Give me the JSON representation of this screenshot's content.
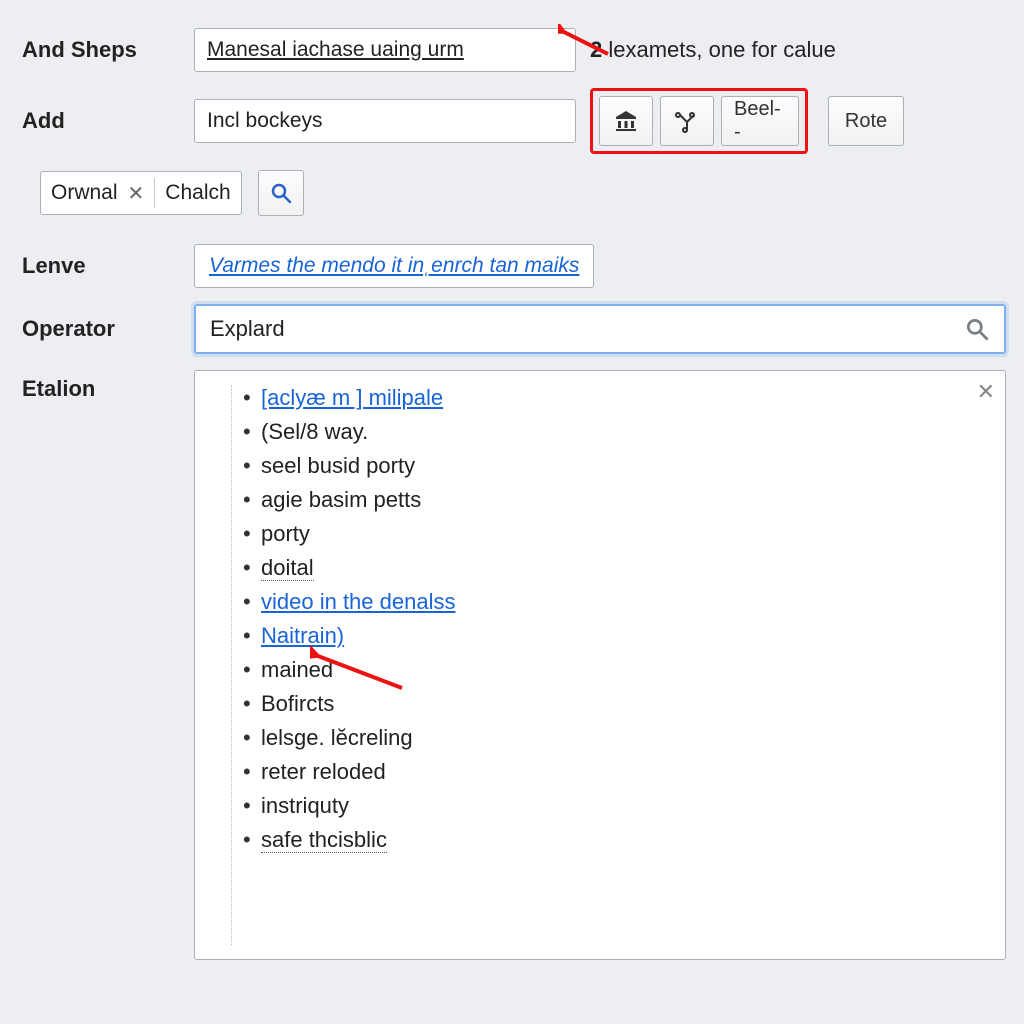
{
  "row1": {
    "label": "And Sheps",
    "input_value": "Manesal iachase uaing urm",
    "helper_prefix": "2",
    "helper_text": "lexamets, one for calue"
  },
  "row2": {
    "label": "Add",
    "input_value": "Incl bockeys",
    "toolbar": {
      "btn1_icon": "bank-icon",
      "btn2_icon": "branch-icon",
      "btn3_label": "Beel--"
    },
    "rote_label": "Rote"
  },
  "tags": {
    "item1_a": "Orwnal",
    "item1_b": "Chalch"
  },
  "row_lenve": {
    "label": "Lenve",
    "hint": "Varmes the mendo it inˌenrch tan maiks"
  },
  "row_operator": {
    "label": "Operator",
    "value": "Explard"
  },
  "row_etalion": {
    "label": "Etalion"
  },
  "results": {
    "items": [
      {
        "text": "[aclyæ m ] milipale",
        "style": "link"
      },
      {
        "text": "(Sel/8 way.",
        "style": "plain"
      },
      {
        "text": "seel busid porty",
        "style": "plain"
      },
      {
        "text": "agie basim petts",
        "style": "plain"
      },
      {
        "text": "porty",
        "style": "plain"
      },
      {
        "text": "doital",
        "style": "dotted"
      },
      {
        "text": "video in the denalss",
        "style": "link"
      },
      {
        "text": "Naitrain)",
        "style": "link"
      },
      {
        "text": "mained",
        "style": "plain"
      },
      {
        "text": "Bofircts",
        "style": "plain"
      },
      {
        "text": "lelsge. lĕcreling",
        "style": "plain"
      },
      {
        "text": "reter reloded",
        "style": "plain"
      },
      {
        "text": "instriquty",
        "style": "plain"
      },
      {
        "text": "safe thcisblic",
        "style": "dotted"
      }
    ]
  }
}
